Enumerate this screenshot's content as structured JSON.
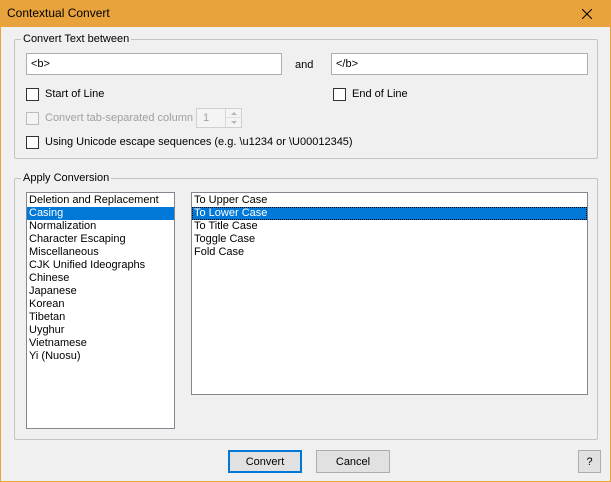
{
  "window": {
    "title": "Contextual Convert"
  },
  "convert_group": {
    "title": "Convert Text between",
    "start_value": "<b>",
    "and_label": "and",
    "end_value": "</b>",
    "start_of_line": {
      "label": "Start of Line",
      "checked": false
    },
    "end_of_line": {
      "label": "End of Line",
      "checked": false
    },
    "tab_column": {
      "label": "Convert tab-separated column",
      "checked": false,
      "enabled": false,
      "column": "1"
    },
    "unicode_escape": {
      "label": "Using Unicode escape sequences (e.g. \\u1234 or \\U00012345)",
      "checked": false
    }
  },
  "apply_group": {
    "title": "Apply Conversion",
    "categories": [
      "Deletion and Replacement",
      "Casing",
      "Normalization",
      "Character Escaping",
      "Miscellaneous",
      "CJK Unified Ideographs",
      "Chinese",
      "Japanese",
      "Korean",
      "Tibetan",
      "Uyghur",
      "Vietnamese",
      "Yi (Nuosu)"
    ],
    "selected_category": "Casing",
    "operations": [
      "To Upper Case",
      "To Lower Case",
      "To Title Case",
      "Toggle Case",
      "Fold Case"
    ],
    "selected_operation": "To Lower Case"
  },
  "buttons": {
    "convert": "Convert",
    "cancel": "Cancel",
    "help": "?"
  },
  "colors": {
    "titlebar": "#e8a33c",
    "selection": "#0078d7",
    "window_bg": "#f0f0f0"
  },
  "icons": {
    "close": "close-icon"
  }
}
